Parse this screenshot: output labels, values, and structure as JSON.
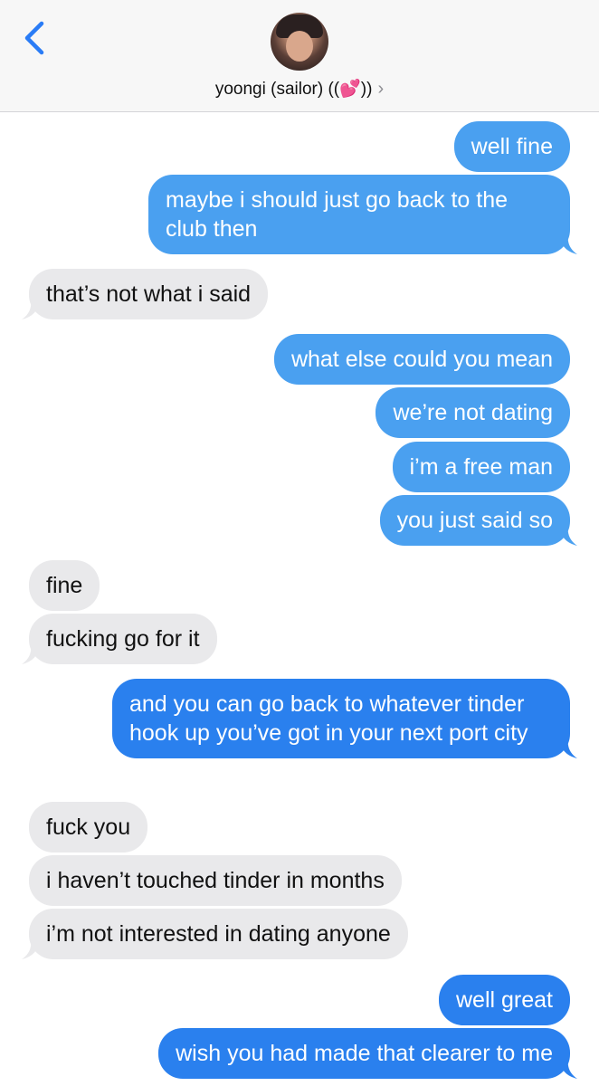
{
  "header": {
    "contact_name": "yoongi (sailor) ((",
    "heart_icon": "💕",
    "name_suffix": "))",
    "chevron": "›"
  },
  "colors": {
    "sent_bubble": "#4aa0f0",
    "sent_bubble_dark": "#2a80ee",
    "received_bubble": "#e9e9eb",
    "header_bg": "#f7f7f7",
    "back_arrow": "#2a7cf6"
  },
  "messages": [
    {
      "sender": "me",
      "text": "well fine"
    },
    {
      "sender": "me",
      "text": "maybe i should just go back to the club then"
    },
    {
      "sender": "them",
      "text": "that’s not what i said"
    },
    {
      "sender": "me",
      "text": "what else could you mean"
    },
    {
      "sender": "me",
      "text": "we’re not dating"
    },
    {
      "sender": "me",
      "text": "i’m a free man"
    },
    {
      "sender": "me",
      "text": "you just said so"
    },
    {
      "sender": "them",
      "text": "fine"
    },
    {
      "sender": "them",
      "text": "fucking go for it"
    },
    {
      "sender": "me",
      "text": "and you can go back to whatever tinder hook up you’ve got in your next port city"
    },
    {
      "sender": "them",
      "text": "fuck you"
    },
    {
      "sender": "them",
      "text": "i haven’t touched tinder in months"
    },
    {
      "sender": "them",
      "text": "i’m not interested in dating anyone"
    },
    {
      "sender": "me",
      "text": "well great"
    },
    {
      "sender": "me",
      "text": "wish you had made that clearer to me"
    }
  ]
}
